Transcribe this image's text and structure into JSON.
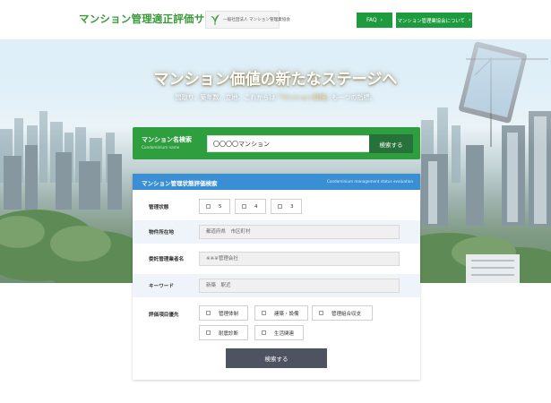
{
  "header": {
    "site_title": "マンション管理適正評価サイト",
    "association_logo_text": "一般社団法人 マンション管理業協会",
    "faq_label": "FAQ",
    "about_label": "マンション管理業協会について"
  },
  "hero": {
    "headline": "マンション価値の新たなステージへ",
    "sub_before": "間取り、築年数、立地、これからは",
    "sub_highlight": "「マンション管理」",
    "sub_after": "も一つの指標。"
  },
  "name_search": {
    "label_jp": "マンション名検索",
    "label_en": "Condominium name",
    "input_value": "〇〇〇〇マンション",
    "button_label": "検索する"
  },
  "eval_search": {
    "title_jp": "マンション管理状態評価検索",
    "title_en": "Condominium management status evaluation",
    "status": {
      "label": "管理状態",
      "options": [
        "5",
        "4",
        "3"
      ]
    },
    "location": {
      "label": "物件所在地",
      "value": "都道府県　市区町村"
    },
    "company": {
      "label": "委託管理業者名",
      "value": "※※※管理会社"
    },
    "keyword": {
      "label": "キーワード",
      "value": "新築　駅近"
    },
    "priority": {
      "label": "評価項目優先",
      "options": [
        "管理体制",
        "建築・設備",
        "管理組合収支",
        "耐震診断",
        "生活関連"
      ]
    },
    "submit_label": "検索する"
  },
  "colors": {
    "brand_green": "#1e9a3f",
    "panel_green": "#2f9e3f",
    "panel_blue": "#3a8fd4",
    "submit_gray": "#4d5360"
  }
}
